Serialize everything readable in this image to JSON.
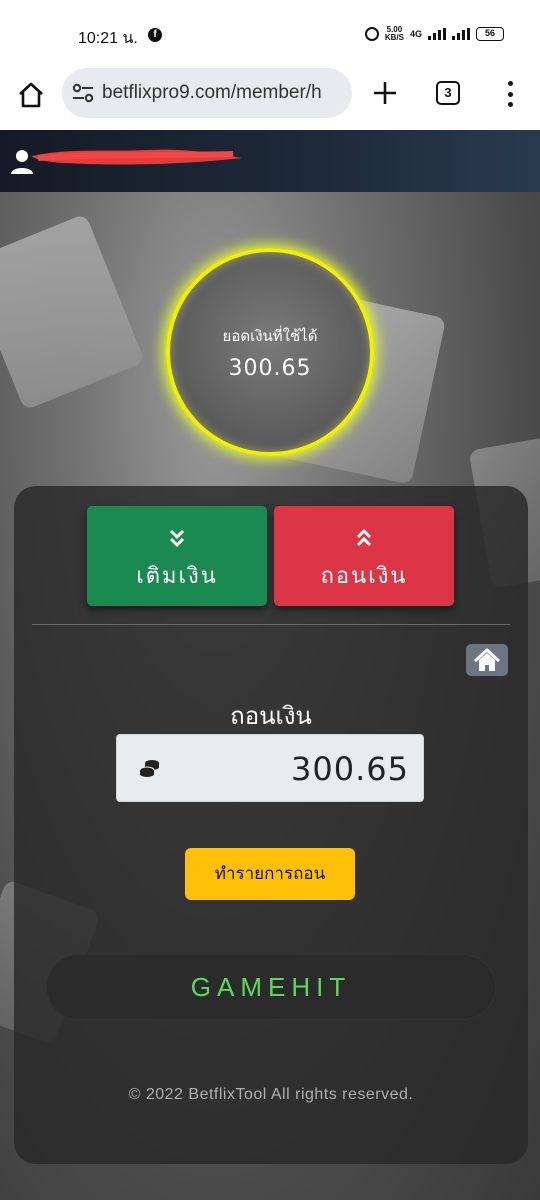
{
  "status_bar": {
    "time": "10:21 น.",
    "network_speed": "5.00\nKB/S",
    "network_type": "4G",
    "battery": "56"
  },
  "browser": {
    "url": "betflixpro9.com/member/h",
    "tab_count": "3"
  },
  "balance": {
    "label": "ยอดเงินที่ใช้ได้",
    "value": "300.65"
  },
  "tabs": {
    "deposit_label": "เติมเงิน",
    "withdraw_label": "ถอนเงิน"
  },
  "withdraw_form": {
    "title": "ถอนเงิน",
    "amount_value": "300.65",
    "submit_label": "ทำรายการถอน"
  },
  "brand": {
    "label": "GAMEHIT"
  },
  "footer": {
    "text": "© 2022 BetflixTool All rights reserved."
  },
  "colors": {
    "deposit": "#1a8a52",
    "withdraw": "#dc3545",
    "submit": "#ffc107",
    "glow": "#f0f000",
    "brand_text": "#5dd85d"
  },
  "icons": [
    "home-icon",
    "site-settings-icon",
    "plus-icon",
    "tabs-icon",
    "more-menu-icon",
    "user-icon",
    "chevrons-down-icon",
    "chevrons-up-icon",
    "home-icon",
    "coins-icon"
  ]
}
